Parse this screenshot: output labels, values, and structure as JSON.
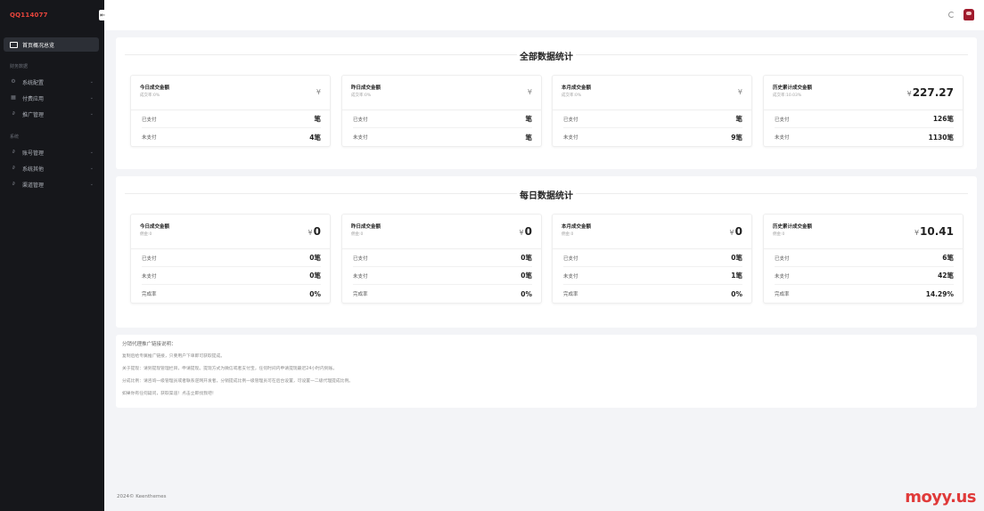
{
  "brand": "QQ114077",
  "sidebar": {
    "active": "首页概况总览",
    "groups": [
      {
        "title": "财务数据",
        "items": [
          "系统配置",
          "付费应用",
          "推广管理"
        ]
      },
      {
        "title": "系统",
        "items": [
          "账号管理",
          "系统其他",
          "渠道管理"
        ]
      }
    ]
  },
  "overall": {
    "title": "全部数据统计",
    "cards": [
      {
        "title": "今日成交金额",
        "sub": "成交率:0%",
        "amount": "",
        "rows": [
          {
            "label": "已支付",
            "value": "笔"
          },
          {
            "label": "未支付",
            "value": "4笔"
          }
        ]
      },
      {
        "title": "昨日成交金额",
        "sub": "成交率:0%",
        "amount": "",
        "rows": [
          {
            "label": "已支付",
            "value": "笔"
          },
          {
            "label": "未支付",
            "value": "笔"
          }
        ]
      },
      {
        "title": "本月成交金额",
        "sub": "成交率:0%",
        "amount": "",
        "rows": [
          {
            "label": "已支付",
            "value": "笔"
          },
          {
            "label": "未支付",
            "value": "9笔"
          }
        ]
      },
      {
        "title": "历史累计成交金额",
        "sub": "成交率:10.03%",
        "amount": "227.27",
        "rows": [
          {
            "label": "已支付",
            "value": "126笔"
          },
          {
            "label": "未支付",
            "value": "1130笔"
          }
        ]
      }
    ]
  },
  "daily": {
    "title": "每日数据统计",
    "cards": [
      {
        "title": "今日成交金额",
        "sub": "佣金:0",
        "amount": "0",
        "rows": [
          {
            "label": "已支付",
            "value": "0笔"
          },
          {
            "label": "未支付",
            "value": "0笔"
          },
          {
            "label": "完成率",
            "value": "0%"
          }
        ]
      },
      {
        "title": "昨日成交金额",
        "sub": "佣金:0",
        "amount": "0",
        "rows": [
          {
            "label": "已支付",
            "value": "0笔"
          },
          {
            "label": "未支付",
            "value": "0笔"
          },
          {
            "label": "完成率",
            "value": "0%"
          }
        ]
      },
      {
        "title": "本月成交金额",
        "sub": "佣金:0",
        "amount": "0",
        "rows": [
          {
            "label": "已支付",
            "value": "0笔"
          },
          {
            "label": "未支付",
            "value": "1笔"
          },
          {
            "label": "完成率",
            "value": "0%"
          }
        ]
      },
      {
        "title": "历史累计成交金额",
        "sub": "佣金:0",
        "amount": "10.41",
        "rows": [
          {
            "label": "已支付",
            "value": "6笔"
          },
          {
            "label": "未支付",
            "value": "42笔"
          },
          {
            "label": "完成率",
            "value": "14.29%"
          }
        ]
      }
    ]
  },
  "currency": "¥",
  "notice": {
    "title": "分销代理推广链接说明：",
    "lines": [
      "复制后给专属推广链接，只要用户下单即可获取提成。",
      "关于提现：请到提现管理栏目，申请提现。提现方式为微信或者支付宝，任何时间内申请提现最迟24小时内到账。",
      "分成比例：请咨询一级管理员或者联系逆网开发者，分销提成比例一级管理员可在后台设置，可设置一二级代理提成比例。",
      "如果你有任何疑问，获取渠道！点击立即找我吧！"
    ]
  },
  "footer": "2024© Keenthemes",
  "watermark": "moyy.us"
}
